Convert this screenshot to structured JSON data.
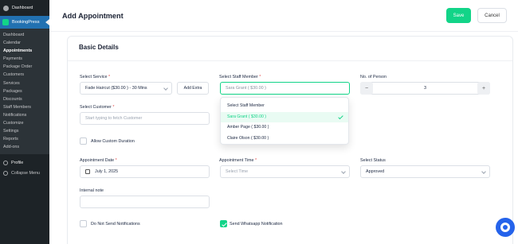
{
  "wp_sidebar": {
    "dashboard": "Dashboard",
    "plugin": "BookingPress",
    "items": [
      "Dashboard",
      "Calendar",
      "Appointments",
      "Payments",
      "Package Order",
      "Customers",
      "Services",
      "Packages",
      "Discounts",
      "Staff Members",
      "Notifications",
      "Customize",
      "Settings",
      "Reports",
      "Add-ons"
    ],
    "active_item": "Appointments",
    "profile": "Profile",
    "collapse": "Collapse Menu"
  },
  "header": {
    "title": "Add Appointment",
    "save_label": "Save",
    "cancel_label": "Cancel",
    "accent": "#12d488"
  },
  "section": {
    "title": "Basic Details"
  },
  "form": {
    "service_label": "Select Service",
    "service_value": "Fade Haircut ($30.00 ) - 30 Mins",
    "add_extra_label": "Add Extra",
    "staff_label": "Select Staff Member",
    "staff_value": "Sara Grant ( $30.00 )",
    "persons_label": "No. of Person",
    "persons_value": "3",
    "minus": "−",
    "plus": "+",
    "customer_label": "Select Customer",
    "customer_placeholder": "Start typing to fetch Customer",
    "custom_duration_label": "Allow Custom Duration",
    "date_label": "Appointment Date",
    "date_value": "July 1, 2025",
    "time_label": "Appointment Time",
    "time_placeholder": "Select Time",
    "status_label": "Select Status",
    "status_value": "Approved",
    "note_label": "Internal note",
    "no_notify_label": "Do Not Send Notifications",
    "whatsapp_label": "Send Whatsapp Notification",
    "required_mark": "*"
  },
  "staff_dropdown": {
    "options": [
      "Select Staff Member",
      "Sara Grant ( $30.00 )",
      "Amber Page ( $30.00 )",
      "Claire Olson ( $30.00 )"
    ],
    "selected_index": 1
  }
}
